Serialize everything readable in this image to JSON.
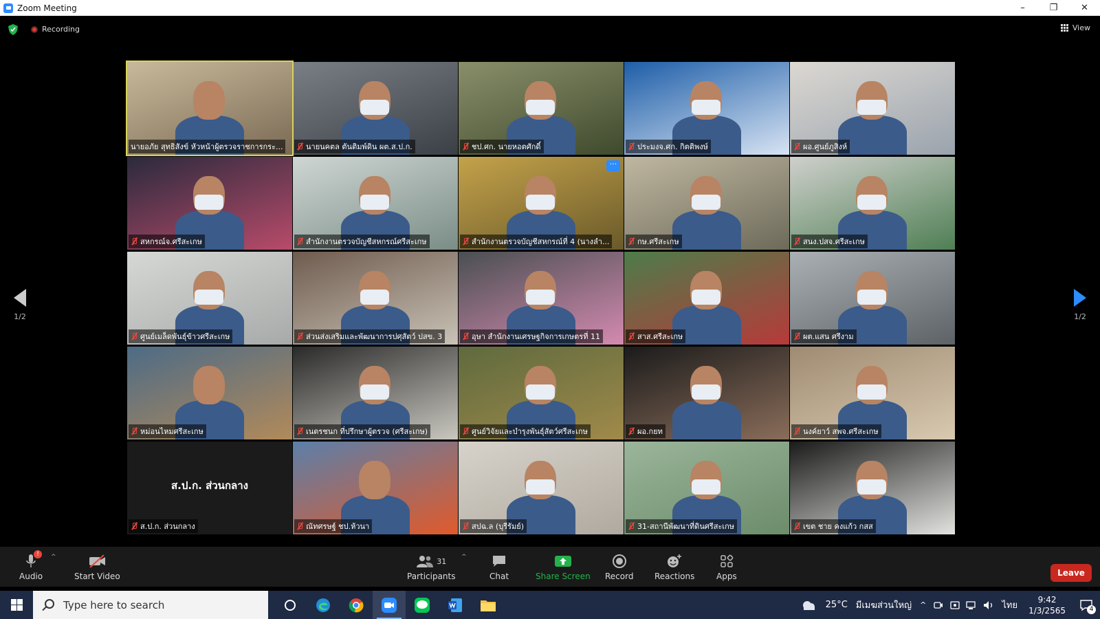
{
  "window": {
    "title": "Zoom Meeting",
    "min": "–",
    "max": "❐",
    "close": "✕"
  },
  "topbar": {
    "recording_label": "Recording",
    "view_label": "View"
  },
  "paging": {
    "left_label": "1/2",
    "right_label": "1/2"
  },
  "tiles": [
    {
      "name": "นายอภัย สุทธิสังข์ หัวหน้าผู้ตรวจราชการกระ...",
      "muted": false,
      "active": true
    },
    {
      "name": "นายนคตล ตันติมพ์ดิน ผต.ส.ป.ก.",
      "muted": true
    },
    {
      "name": "ชป.ศก. นายหอตศักดิ์",
      "muted": true
    },
    {
      "name": "ประมงจ.ศก. กิตติพงษ์",
      "muted": true
    },
    {
      "name": "ผอ.ศูนย์ภูสิงห์",
      "muted": true
    },
    {
      "name": "สหกรณ์จ.ศรีสะเกษ",
      "muted": true
    },
    {
      "name": "สำนักงานตรวจบัญชีสหกรณ์ศรีสะเกษ",
      "muted": true
    },
    {
      "name": "สำนักงานตรวจบัญชีสหกรณ์ที่ 4 (นางลำ...",
      "muted": true,
      "more": "···"
    },
    {
      "name": "กษ.ศรีสะเกษ",
      "muted": true
    },
    {
      "name": "สนง.ปสจ.ศรีสะเกษ",
      "muted": true
    },
    {
      "name": "ศูนย์เมล็ดพันธุ์ข้าวศรีสะเกษ",
      "muted": true
    },
    {
      "name": "ส่วนส่งเสริมและพัฒนาการปศุสัตว์ ปสข. 3",
      "muted": true
    },
    {
      "name": "อุษา สำนักงานเศรษฐกิจการเกษตรที่ 11",
      "muted": true
    },
    {
      "name": "สาส.ศรีสะเกษ",
      "muted": true
    },
    {
      "name": "ผต.แสน ศรีงาม",
      "muted": true
    },
    {
      "name": "หม่อนไหมศรีสะเกษ",
      "muted": true
    },
    {
      "name": "เนตรชนก ที่ปรึกษาผู้ตรวจ (ศรีสะเกษ)",
      "muted": true
    },
    {
      "name": "ศูนย์วิจัยและบำรุงพันธุ์สัตว์ศรีสะเกษ",
      "muted": true
    },
    {
      "name": "ผอ.กยท",
      "muted": true
    },
    {
      "name": "นงค์ยาว์ สพจ.ศรีสะเกษ",
      "muted": true
    },
    {
      "name": "ส.ป.ก. ส่วนกลาง",
      "muted": true,
      "display_name": "ส.ป.ก. ส่วนกลาง"
    },
    {
      "name": "ณัทศรษฐ์ ชป.ห้วนา",
      "muted": true
    },
    {
      "name": "สปฉ.ล (บุรีรัมย์)",
      "muted": true
    },
    {
      "name": "31-สถานีพัฒนาที่ดินศรีสะเกษ",
      "muted": true
    },
    {
      "name": "เขต ชาย คงแก้ว กสส",
      "muted": true
    }
  ],
  "toolbar": {
    "audio_label": "Audio",
    "audio_badge": "!",
    "video_label": "Start Video",
    "participants_label": "Participants",
    "participants_count": "31",
    "chat_label": "Chat",
    "share_label": "Share Screen",
    "record_label": "Record",
    "reactions_label": "Reactions",
    "apps_label": "Apps",
    "leave_label": "Leave"
  },
  "taskbar": {
    "search_placeholder": "Type here to search",
    "weather": "25°C",
    "weather_desc": "มีเมฆส่วนใหญ่",
    "lang": "ไทย",
    "time": "9:42",
    "date": "1/3/2565",
    "notif_count": "4"
  },
  "colors": {
    "accent": "#2d8cff",
    "active_speaker": "#d8d35a",
    "leave": "#c8281f",
    "share": "#24b24a"
  }
}
